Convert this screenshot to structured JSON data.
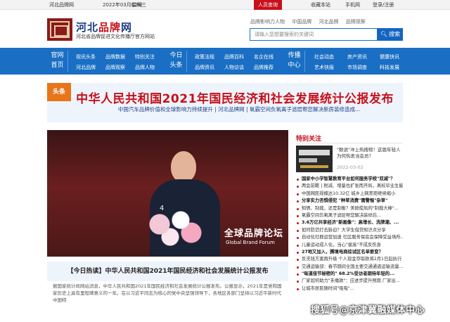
{
  "topbar": {
    "site": "河北品牌网",
    "date": "2022年03月02号",
    "weekday": "星期三",
    "query": "人员查询",
    "favorite": "收藏本站",
    "app": "手机网",
    "login": "登录/注册"
  },
  "header": {
    "logo_title_prefix": "河北",
    "logo_title_red": "品牌",
    "logo_title_suffix": "网",
    "logo_sub": "河北省品牌促进文化传播厅官方网站",
    "links": [
      "品牌影响力人物",
      "中国品牌",
      "河北品牌",
      "品牌观察"
    ],
    "search_placeholder": "请输入您想要搜索的关键词",
    "search_button": "搜索"
  },
  "nav": {
    "home": [
      "官网",
      "首页"
    ],
    "col1": [
      "视讯头条",
      "河北品牌"
    ],
    "col2": [
      "品牌数据",
      "品牌观察"
    ],
    "col3": [
      "特别关注",
      "品牌人物"
    ],
    "today": [
      "今日",
      "头条"
    ],
    "col4": [
      "政策法规",
      "品牌资讯"
    ],
    "col5": [
      "品牌百科",
      "人物访谈"
    ],
    "col6": [
      "名企在线",
      "品牌推荐"
    ],
    "broadcast": [
      "传播",
      "中心"
    ],
    "col7": [
      "社会动态",
      "艺术快报"
    ],
    "col8": [
      "房产资讯",
      "市场调查"
    ],
    "col9": [
      "健康快讯",
      "科技发展"
    ]
  },
  "banner": {
    "tag": "头条",
    "title": "中华人民共和国2021年国民经济和社会发展统计公报发布",
    "sub": "中国汽车品牌价值和全球影响力持续提升  |  河北品牌网  |  氧霸空间负氧离子滤层帮您解决新房装修造成..."
  },
  "photo": {
    "caption_cn": "全球品牌论坛",
    "caption_en": "Global Brand Forum",
    "number": "4"
  },
  "news": {
    "title": "【今日热读】中华人民共和国2021年国民经济和社会发展统计公报发布",
    "desc": "据国家统计局网站消息，中华人民共和国2021年国民经济和社会发展统计公报发布。公报显示，2021年是党和国家历史上具有里程碑意义的一年。在以习近平同志为核心的党中央坚强领导下，各地区各部门坚持以习近平新时代中国特"
  },
  "sidebar": {
    "heading": "特别关注",
    "feature_text": "\"数说\"冲上热搜榜！这届年轻人为何热衷当会员？",
    "feature_date": "2022-03-02",
    "items": [
      {
        "text": "国家中小学智慧教育平台如何服务学校\"双减\"？",
        "bold": true
      },
      {
        "text": "两会前瞻 | 税减、增量也扩张而开局，离校毕业生能...",
        "bold": false
      },
      {
        "text": "中国网民规模达10.32亿 城乡上网差距继续缩小",
        "bold": false
      },
      {
        "text": "分享实力否惧侵犯 \"种草消费\"需警惕\"杂草\"",
        "bold": true
      },
      {
        "text": "知情、制裁，还是制衡？美欧搅局的\"制裁大棒\"...",
        "bold": false
      },
      {
        "text": "氧霸空间负氧离子滤层帮您解决装修后...",
        "bold": false
      },
      {
        "text": "3.6万亿共享经济\"新画像\"：高增长、洗牌潮、...",
        "bold": true
      },
      {
        "text": "如何防范打击胁迫？大学生借贷知识点分享",
        "bold": false
      },
      {
        "text": "自动化社群运营加速 社区服务保底会保障受益场所...",
        "bold": false
      },
      {
        "text": "儿童运动成人化，当心\"拔高\"不成反伤身",
        "bold": false
      },
      {
        "text": "27地又加入，腾境电商综试区名单要变？",
        "bold": true
      },
      {
        "text": "反洗钱方案再升级 个人现金存取款将2月1日起执行",
        "bold": false
      },
      {
        "text": "交通运输部：春节期间全国主要交通通道运输流量...",
        "bold": false
      },
      {
        "text": "\"每道佳节秘密的\" 68.2%受访者期待年轻的...",
        "bold": true
      },
      {
        "text": "厂家如何助力\"未缴款\"：应进步提升预期 厂家出...",
        "bold": false
      },
      {
        "text": "让城市居民随时间\"吸吸\"...",
        "bold": false
      }
    ]
  },
  "watermark": "搜狐号@京津冀融媒体中心"
}
